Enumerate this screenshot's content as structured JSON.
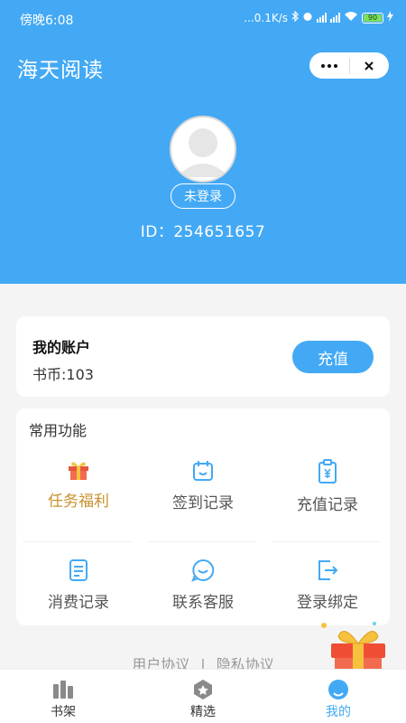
{
  "status_bar": {
    "time": "傍晚6:08",
    "speed": "...0.1K/s",
    "battery": "90"
  },
  "app": {
    "title": "海天阅读"
  },
  "profile": {
    "login_label": "未登录",
    "user_id": "ID：254651657"
  },
  "account": {
    "title": "我的账户",
    "coins": "书币:103",
    "recharge_label": "充值"
  },
  "functions": {
    "title": "常用功能",
    "items": [
      {
        "label": "任务福利",
        "icon": "gift-icon"
      },
      {
        "label": "签到记录",
        "icon": "calendar-icon"
      },
      {
        "label": "充值记录",
        "icon": "clipboard-yen-icon"
      },
      {
        "label": "消费记录",
        "icon": "document-icon"
      },
      {
        "label": "联系客服",
        "icon": "smile-chat-icon"
      },
      {
        "label": "登录绑定",
        "icon": "exit-icon"
      }
    ]
  },
  "footer": {
    "user_agreement": "用户协议",
    "separator": "|",
    "privacy_agreement": "隐私协议"
  },
  "tabbar": {
    "items": [
      {
        "label": "书架",
        "icon": "bookshelf-icon",
        "active": false
      },
      {
        "label": "精选",
        "icon": "star-badge-icon",
        "active": false
      },
      {
        "label": "我的",
        "icon": "person-icon",
        "active": true
      }
    ]
  },
  "colors": {
    "primary": "#43a9f5",
    "gold": "#c8912d",
    "background": "#f4f4f4"
  }
}
